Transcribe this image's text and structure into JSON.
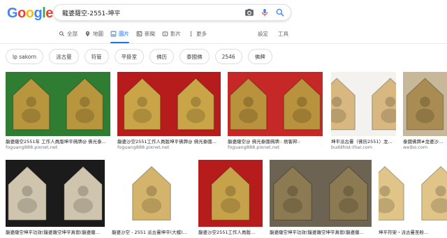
{
  "logo": [
    "G",
    "o",
    "o",
    "g",
    "l",
    "e"
  ],
  "logo_colors": [
    "#4285f4",
    "#ea4335",
    "#fbbc05",
    "#4285f4",
    "#34a853",
    "#ea4335"
  ],
  "search": {
    "query": "龍婆薩空-2551-坤平"
  },
  "tabs": [
    {
      "label": "全部",
      "icon": "search-icon",
      "active": false
    },
    {
      "label": "地圖",
      "icon": "map-pin-icon",
      "active": false
    },
    {
      "label": "圖片",
      "icon": "image-icon",
      "active": true
    },
    {
      "label": "新聞",
      "icon": "news-icon",
      "active": false
    },
    {
      "label": "影片",
      "icon": "video-icon",
      "active": false
    },
    {
      "label": "更多",
      "icon": "more-dots-icon",
      "active": false
    }
  ],
  "tools": {
    "settings": "設定",
    "tools": "工具"
  },
  "chips": [
    "lp sakorn",
    "派古曼",
    "符管",
    "平掛室",
    "佛历",
    "泰國佛",
    "2546",
    "佛牌"
  ],
  "results_row1": [
    {
      "caption": "龍婆薩空2551年 工作人員版坤平佛牌@ 佛光泰...",
      "source": "foguang888.pixnet.net",
      "bg": "#2e7d32",
      "amulet": "#b8963e"
    },
    {
      "caption": "龍婆沙空2551工作人員版坤平佛牌@ 佛光泰國...",
      "source": "foguang888.pixnet.net",
      "bg": "#b71c1c",
      "amulet": "#c9a548"
    },
    {
      "caption": "龍婆薩空@ 佛光泰國佛牌:: 痞客邦::",
      "source": "foguang888.pixnet.net",
      "bg": "#c62828",
      "amulet": "#b8923c"
    },
    {
      "caption": "坤平派古曼（佛历2551）龙...",
      "source": "buddhist-thai.com",
      "bg": "#f4f2ee",
      "amulet": "#d8b880"
    },
    {
      "caption": "泰國佛牌#龙婆沙空2551",
      "source": "weibo.com",
      "bg": "#c8b89a",
      "amulet": "#a98c52"
    }
  ],
  "results_row2": [
    {
      "caption": "龍婆薩空坤平功效(龍婆薩空坤平真假(龍婆薩...",
      "bg": "#1b1b1b",
      "amulet": "#cfc4ae"
    },
    {
      "caption": "龍婆沙空 - 2551 派古曼坤平(大模)...",
      "bg": "#ffffff",
      "amulet": "#d4b46c"
    },
    {
      "caption": "龍婆沙空2551工作人員版...",
      "bg": "#b71c1c",
      "amulet": "#c6a24a"
    },
    {
      "caption": "龍婆薩空坤平功效(龍婆薩空坤平真假(龍婆薩...",
      "bg": "#6d6352",
      "amulet": "#8c7a52"
    },
    {
      "caption": "坤平符架・派古曼圣粉...",
      "bg": "#ffffff",
      "amulet": "#e0c488"
    }
  ]
}
